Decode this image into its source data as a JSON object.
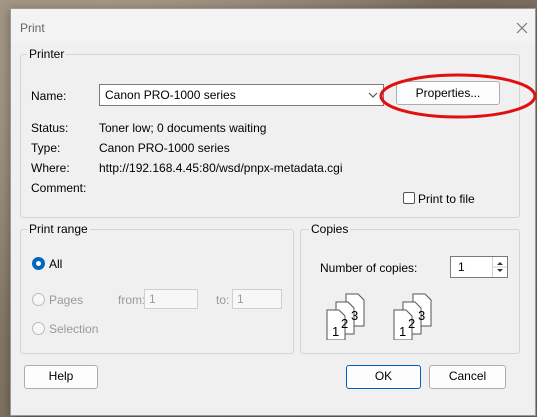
{
  "dialog": {
    "title": "Print"
  },
  "printer": {
    "legend": "Printer",
    "name_label": "Name:",
    "name_value": "Canon PRO-1000 series",
    "properties_label": "Properties...",
    "status_label": "Status:",
    "status_value": "Toner low; 0 documents waiting",
    "type_label": "Type:",
    "type_value": "Canon PRO-1000 series",
    "where_label": "Where:",
    "where_value": "http://192.168.4.45:80/wsd/pnpx-metadata.cgi",
    "comment_label": "Comment:",
    "comment_value": "",
    "print_to_file_label": "Print to file"
  },
  "print_range": {
    "legend": "Print range",
    "all_label": "All",
    "pages_label": "Pages",
    "from_label": "from:",
    "from_value": "1",
    "to_label": "to:",
    "to_value": "1",
    "selection_label": "Selection"
  },
  "copies": {
    "legend": "Copies",
    "number_label": "Number of copies:",
    "number_value": "1",
    "collate_digits": [
      "1",
      "2",
      "3"
    ]
  },
  "buttons": {
    "help": "Help",
    "ok": "OK",
    "cancel": "Cancel"
  },
  "colors": {
    "accent": "#0067c0",
    "annotation": "#e01010"
  }
}
